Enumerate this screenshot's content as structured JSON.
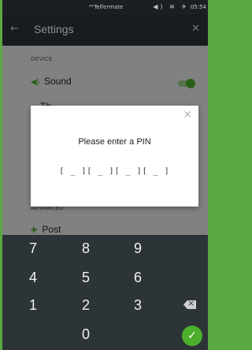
{
  "status_bar": {
    "carrier": "⁴ᴳTelfermate",
    "time": "05:54"
  },
  "appbar": {
    "title": "Settings",
    "back_icon": "arrow-left-icon",
    "close_icon": "close-icon"
  },
  "settings": {
    "section_device": "DEVICE",
    "sound_label": "Sound",
    "partial_row_label": "Th",
    "section_advanced": "ADVANCED",
    "post_label": "Post"
  },
  "dialog": {
    "prompt": "Please enter a PIN",
    "pin_display": "[ _ ][ _ ][ _ ][ _ ]"
  },
  "keypad": {
    "keys": [
      "7",
      "8",
      "9",
      "4",
      "5",
      "6",
      "1",
      "2",
      "3",
      "0"
    ]
  },
  "colors": {
    "accent": "#4caf2b",
    "appbar": "#2d3437",
    "frame": "#5aa842"
  }
}
